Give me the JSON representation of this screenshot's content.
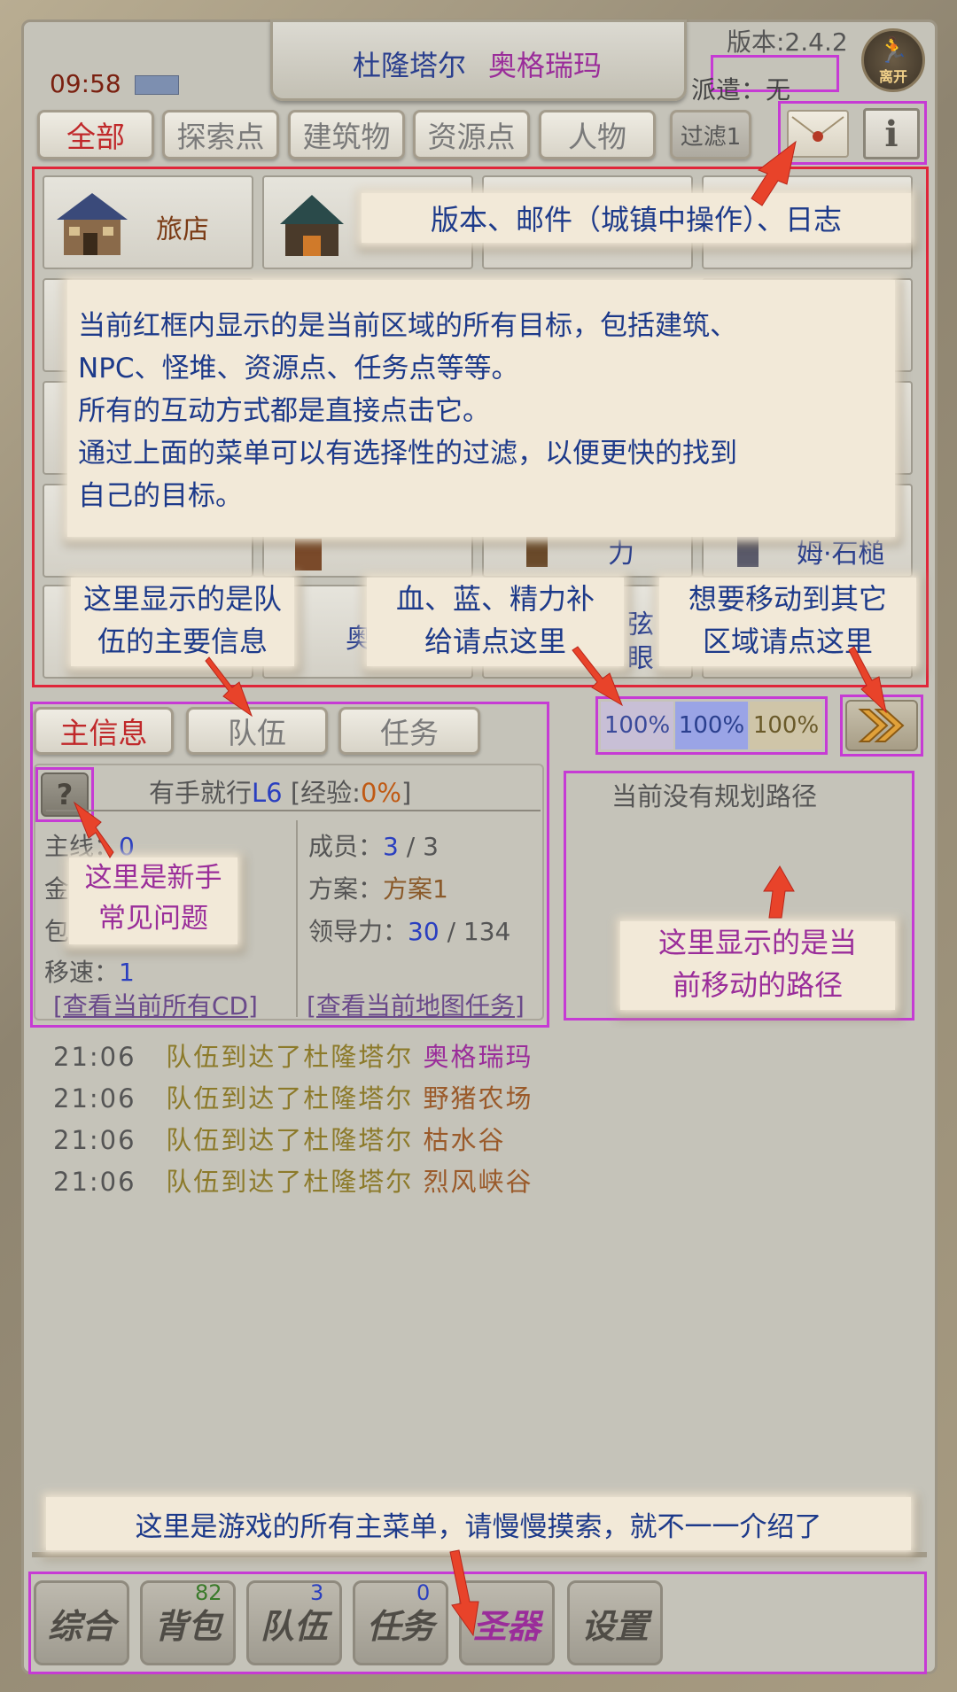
{
  "header": {
    "title_city": "杜隆塔尔",
    "title_area": "奥格瑞玛",
    "time": "09:58",
    "version": "版本:2.4.2",
    "dispatch": "派遣：无",
    "leave": "离开"
  },
  "filter_tabs": [
    {
      "label": "全部"
    },
    {
      "label": "探索点"
    },
    {
      "label": "建筑物"
    },
    {
      "label": "资源点"
    },
    {
      "label": "人物"
    },
    {
      "label": "过滤1"
    }
  ],
  "targets": {
    "inn_label": "旅店",
    "partial_labels": [
      "力",
      "姆·石槌",
      "奥",
      "弦",
      "眼"
    ]
  },
  "info_tabs": [
    {
      "label": "主信息"
    },
    {
      "label": "队伍"
    },
    {
      "label": "任务"
    }
  ],
  "supply": {
    "hp": "100%",
    "mp": "100%",
    "energy": "100%"
  },
  "team": {
    "name": "有手就行",
    "level": "L6",
    "exp_prefix": "[经验:",
    "exp_value": "0%",
    "exp_suffix": "]",
    "left_partial": [
      "主线：",
      "金",
      "包"
    ],
    "main_val": "0",
    "speed_label": "移速：",
    "speed_val": "1",
    "members_label": "成员：",
    "members_val": "3",
    "members_total": "/ 3",
    "plan_label": "方案：",
    "plan_val": "方案1",
    "lead_label": "领导力：",
    "lead_val": "30",
    "lead_total": "/ 134",
    "cd_link": "[查看当前所有CD]",
    "map_task_link": "[查看当前地图任务]"
  },
  "route": {
    "empty": "当前没有规划路径"
  },
  "log": [
    {
      "time": "21:06",
      "text": "队伍到达了杜隆塔尔",
      "place": "奥格瑞玛"
    },
    {
      "time": "21:06",
      "text": "队伍到达了杜隆塔尔",
      "place": "野猪农场"
    },
    {
      "time": "21:06",
      "text": "队伍到达了杜隆塔尔",
      "place": "枯水谷"
    },
    {
      "time": "21:06",
      "text": "队伍到达了杜隆塔尔",
      "place": "烈风峡谷"
    }
  ],
  "notes": {
    "top": "版本、邮件（城镇中操作）、日志",
    "big": [
      "当前红框内显示的是当前区域的所有目标，包括建筑、",
      "NPC、怪堆、资源点、任务点等等。",
      "所有的互动方式都是直接点击它。",
      "通过上面的菜单可以有选择性的过滤，以便更快的找到",
      "自己的目标。"
    ],
    "team": [
      "这里显示的是队",
      "伍的主要信息"
    ],
    "supply": [
      "血、蓝、精力补",
      "给请点这里"
    ],
    "move": [
      "想要移动到其它",
      "区域请点这里"
    ],
    "newbie": [
      "这里是新手",
      "常见问题"
    ],
    "route": [
      "这里显示的是当",
      "前移动的路径"
    ],
    "menu": "这里是游戏的所有主菜单，请慢慢摸索，就不一一介绍了"
  },
  "bottom_menu": [
    {
      "label": "综合",
      "badge": ""
    },
    {
      "label": "背包",
      "badge": "82"
    },
    {
      "label": "队伍",
      "badge": "3"
    },
    {
      "label": "任务",
      "badge": "0"
    },
    {
      "label": "圣器",
      "badge": ""
    },
    {
      "label": "设置",
      "badge": ""
    }
  ],
  "colors": {
    "blue": "#2a3f8e",
    "purple": "#9a2d9a",
    "red": "#c0282a",
    "olive": "#8c7a2a",
    "annotation": "#c63bd4",
    "hp_bg": "#c8bfd6",
    "mp_bg": "#9aa4e6",
    "en_bg": "#cfc5a8"
  }
}
